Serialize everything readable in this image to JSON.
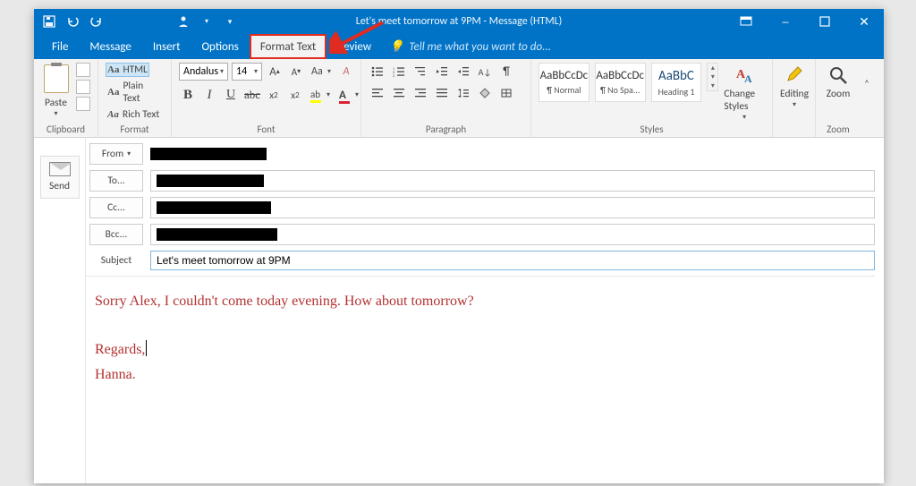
{
  "titlebar": {
    "title": "Let's meet tomorrow at 9PM - Message (HTML)"
  },
  "menu": {
    "file": "File",
    "message": "Message",
    "insert": "Insert",
    "options": "Options",
    "format_text": "Format Text",
    "review": "Review",
    "tell_me": "Tell me what you want to do..."
  },
  "ribbon": {
    "clipboard": {
      "paste": "Paste",
      "label": "Clipboard"
    },
    "format": {
      "html": "Aa HTML",
      "plain": "Aa Plain Text",
      "rich": "Aa Rich Text",
      "label": "Format"
    },
    "font": {
      "name": "Andalus",
      "size": "14",
      "label": "Font"
    },
    "paragraph": {
      "label": "Paragraph"
    },
    "styles": {
      "s1_prev": "AaBbCcDc",
      "s1_name": "¶ Normal",
      "s2_prev": "AaBbCcDc",
      "s2_name": "¶ No Spa...",
      "s3_prev": "AaBbC",
      "s3_name": "Heading 1",
      "change": "Change Styles",
      "label": "Styles"
    },
    "editing": {
      "label": "Editing"
    },
    "zoom": {
      "btn": "Zoom",
      "label": "Zoom"
    }
  },
  "compose": {
    "send": "Send",
    "from": "From",
    "to": "To...",
    "cc": "Cc...",
    "bcc": "Bcc...",
    "subject_label": "Subject",
    "subject": "Let's meet tomorrow at 9PM"
  },
  "body": {
    "line1": "Sorry Alex, I couldn't come today evening. How about tomorrow?",
    "line2": "Regards,",
    "line3": "Hanna."
  }
}
